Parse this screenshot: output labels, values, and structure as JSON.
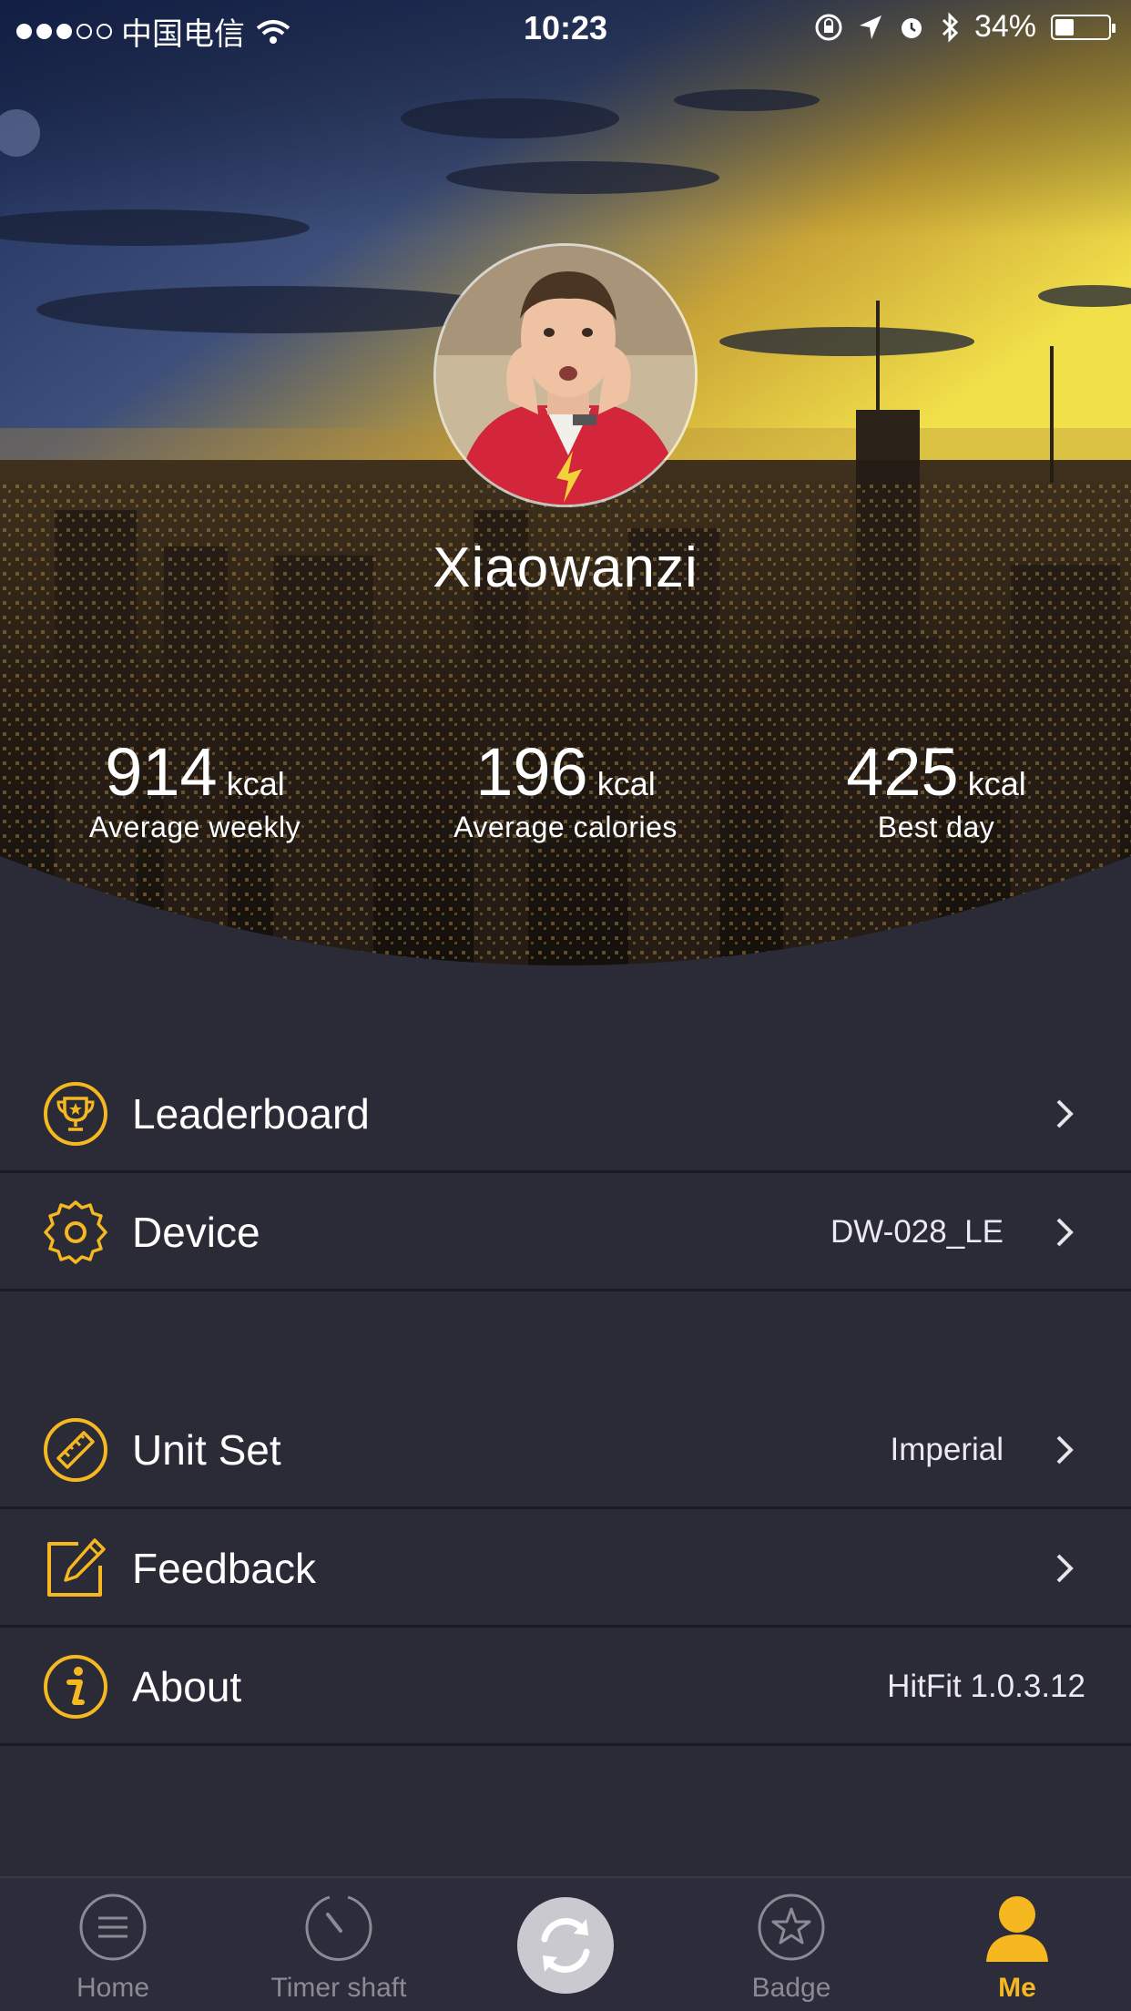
{
  "status_bar": {
    "carrier": "中国电信",
    "time": "10:23",
    "battery": "34%",
    "battery_level": 0.34
  },
  "profile": {
    "username": "Xiaowanzi"
  },
  "stats": [
    {
      "value": "914",
      "unit": "kcal",
      "label": "Average weekly"
    },
    {
      "value": "196",
      "unit": "kcal",
      "label": "Average calories"
    },
    {
      "value": "425",
      "unit": "kcal",
      "label": "Best day"
    }
  ],
  "menu": {
    "leaderboard": {
      "label": "Leaderboard",
      "icon": "trophy-icon"
    },
    "device": {
      "label": "Device",
      "value": "DW-028_LE",
      "icon": "gear-icon"
    },
    "unit_set": {
      "label": "Unit Set",
      "value": "Imperial",
      "icon": "ruler-icon"
    },
    "feedback": {
      "label": "Feedback",
      "icon": "edit-icon"
    },
    "about": {
      "label": "About",
      "value": "HitFit 1.0.3.12",
      "icon": "info-icon"
    }
  },
  "tabbar": {
    "home": "Home",
    "timer": "Timer shaft",
    "badge": "Badge",
    "me": "Me"
  },
  "colors": {
    "accent": "#f5b820",
    "background": "#2b2a37",
    "tabbar": "#2d2c3a",
    "divider": "#1b1a24"
  }
}
